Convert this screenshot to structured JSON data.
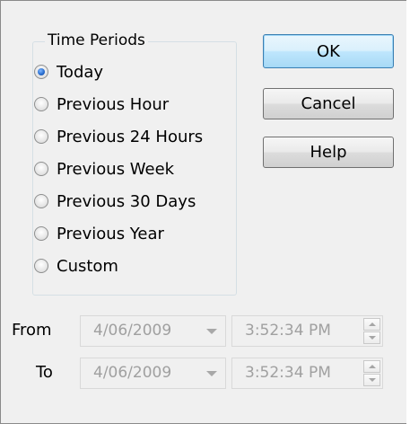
{
  "group": {
    "title": "Time Periods",
    "options": [
      {
        "label": "Today",
        "checked": true
      },
      {
        "label": "Previous Hour",
        "checked": false
      },
      {
        "label": "Previous 24 Hours",
        "checked": false
      },
      {
        "label": "Previous Week",
        "checked": false
      },
      {
        "label": "Previous 30 Days",
        "checked": false
      },
      {
        "label": "Previous Year",
        "checked": false
      },
      {
        "label": "Custom",
        "checked": false
      }
    ]
  },
  "buttons": {
    "ok": "OK",
    "cancel": "Cancel",
    "help": "Help"
  },
  "range": {
    "from": {
      "label": "From",
      "date": "4/06/2009",
      "time": "3:52:34 PM"
    },
    "to": {
      "label": "To",
      "date": "4/06/2009",
      "time": "3:52:34 PM"
    }
  },
  "icons": {
    "dropdown": "chevron-down-icon",
    "spin_up": "spin-up-icon",
    "spin_down": "spin-down-icon"
  },
  "colors": {
    "default_button_border": "#3c7fb1",
    "disabled_text": "#a0a0a0",
    "dialog_background": "#f0f0f0"
  }
}
